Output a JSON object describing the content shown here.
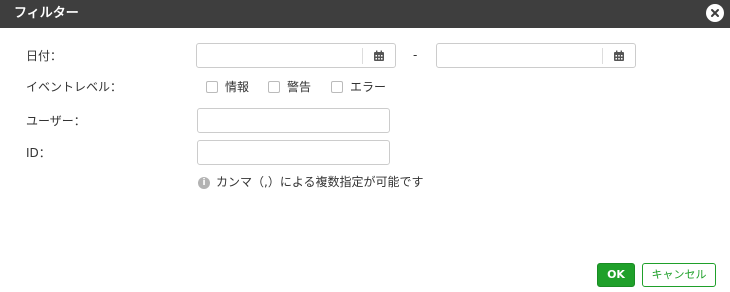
{
  "dialog": {
    "title": "フィルター",
    "close_icon": "close-circle-icon"
  },
  "date": {
    "label": "日付：",
    "separator": "-",
    "from_value": "",
    "to_value": "",
    "calendar_icon": "calendar-icon"
  },
  "event_level": {
    "label": "イベントレベル：",
    "options": [
      {
        "label": "情報",
        "checked": false
      },
      {
        "label": "警告",
        "checked": false
      },
      {
        "label": "エラー",
        "checked": false
      }
    ]
  },
  "user": {
    "label": "ユーザー：",
    "value": ""
  },
  "id": {
    "label": "ID：",
    "value": "",
    "hint": "カンマ（,）による複数指定が可能です",
    "hint_icon": "info-icon"
  },
  "footer": {
    "ok_label": "OK",
    "cancel_label": "キャンセル"
  },
  "colors": {
    "titlebar": "#3e3e3e",
    "accent": "#1fa02a",
    "border": "#cccccc"
  }
}
